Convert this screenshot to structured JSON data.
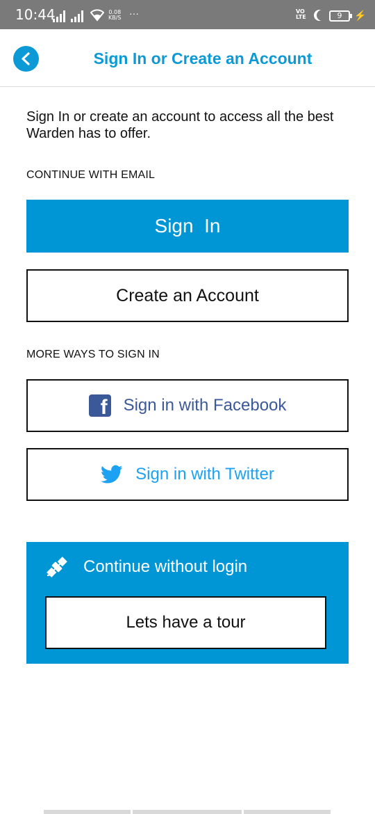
{
  "status_bar": {
    "time": "10:44",
    "net_speed_value": "0.08",
    "net_speed_unit": "KB/S",
    "overflow": "···",
    "volte_top": "VO",
    "volte_bottom": "LTE",
    "battery_level": "9"
  },
  "header": {
    "title": "Sign In or Create an Account",
    "back_icon": "chevron-left-icon",
    "accent_color": "#0b9ad6"
  },
  "intro_text": "Sign In or create an account to access all the best Warden has to offer.",
  "email_section": {
    "label": "CONTINUE WITH EMAIL",
    "sign_in_label": "Sign  In",
    "create_account_label": "Create an Account"
  },
  "social_section": {
    "label": "MORE WAYS TO SIGN IN",
    "facebook_label": "Sign in with Facebook",
    "facebook_icon": "facebook-icon",
    "facebook_color": "#3b5998",
    "twitter_label": "Sign in with Twitter",
    "twitter_icon": "twitter-icon",
    "twitter_color": "#1da1f2"
  },
  "guest_section": {
    "label": "Continue without login",
    "icon": "satellite-icon",
    "tour_label": "Lets have a tour",
    "background_color": "#0096d6"
  }
}
